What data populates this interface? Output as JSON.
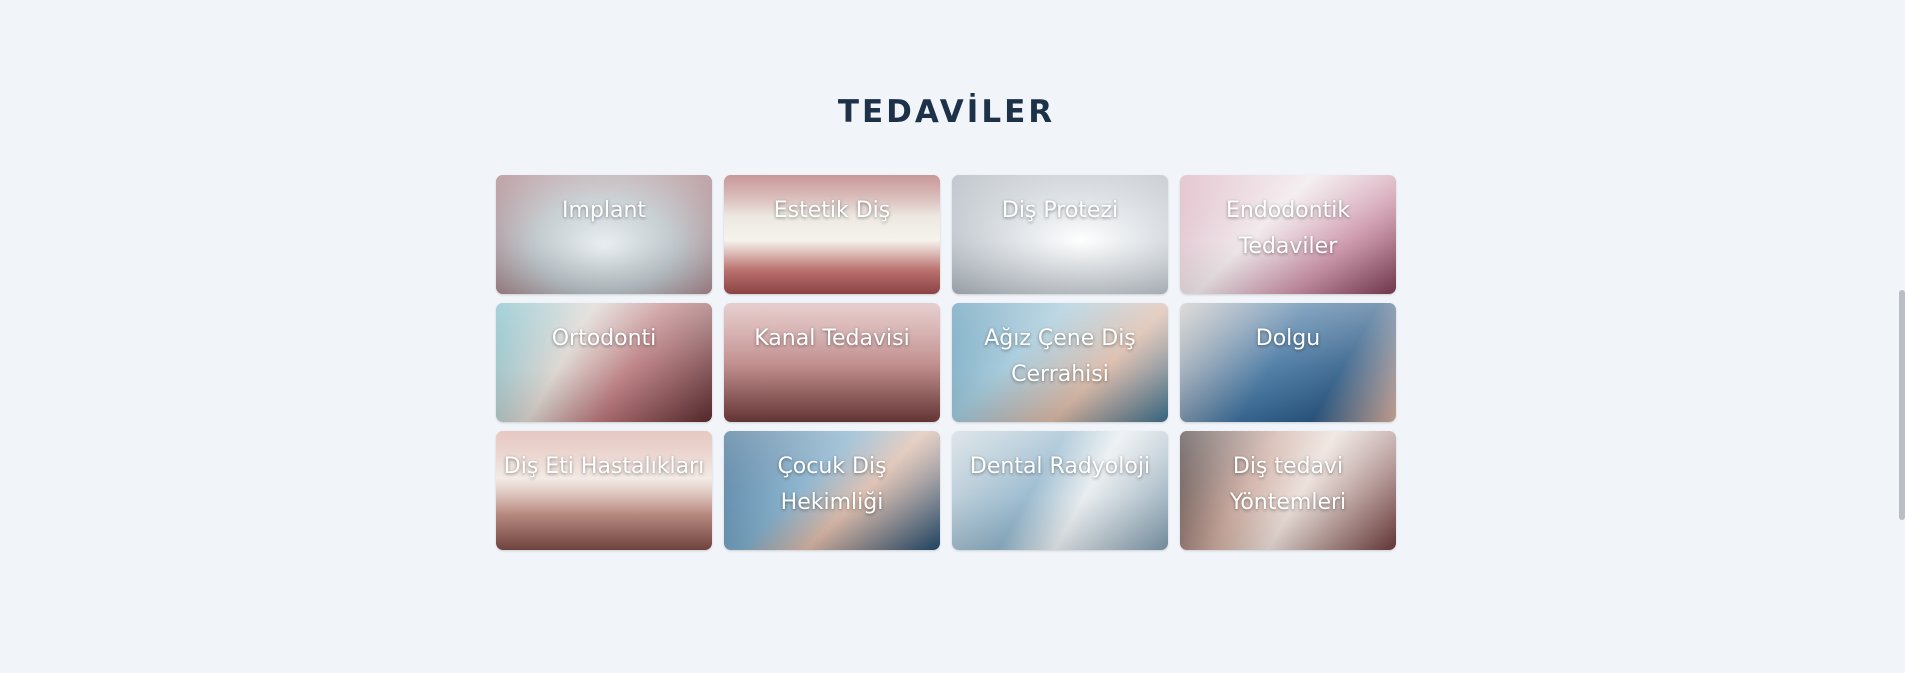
{
  "section": {
    "title": "TEDAVİLER"
  },
  "treatments": [
    {
      "label": "Implant"
    },
    {
      "label": "Estetik Diş"
    },
    {
      "label": "Diş Protezi"
    },
    {
      "label": "Endodontik Tedaviler"
    },
    {
      "label": "Ortodonti"
    },
    {
      "label": "Kanal Tedavisi"
    },
    {
      "label": "Ağız Çene Diş Cerrahisi"
    },
    {
      "label": "Dolgu"
    },
    {
      "label": "Diş Eti Hastalıkları"
    },
    {
      "label": "Çocuk Diş Hekimliği"
    },
    {
      "label": "Dental Radyoloji"
    },
    {
      "label": "Diş tedavi Yöntemleri"
    }
  ],
  "colors": {
    "background": "#f1f4f8",
    "title": "#1d3148",
    "card_text": "#ffffff"
  }
}
